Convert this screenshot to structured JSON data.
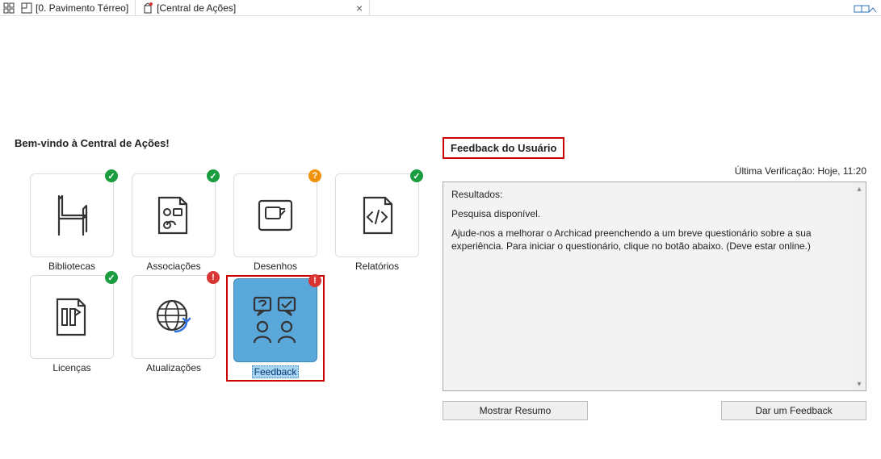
{
  "tabs": {
    "tab1_label": "[0. Pavimento Térreo]",
    "tab2_label": "[Central de Ações]"
  },
  "left": {
    "welcome": "Bem-vindo à Central de Ações!",
    "tiles": {
      "bibliotecas": {
        "label": "Bibliotecas"
      },
      "associacoes": {
        "label": "Associações"
      },
      "desenhos": {
        "label": "Desenhos"
      },
      "relatorios": {
        "label": "Relatórios"
      },
      "licencas": {
        "label": "Licenças"
      },
      "atualizacoes": {
        "label": "Atualizações"
      },
      "feedback": {
        "label": "Feedback"
      }
    },
    "badges": {
      "check": "✓",
      "question": "?",
      "alert": "!"
    }
  },
  "right": {
    "section_title": "Feedback do Usuário",
    "last_check": "Última Verificação: Hoje, 11:20",
    "results_title": "Resultados:",
    "results_line": "Pesquisa disponível.",
    "results_help": "Ajude-nos a melhorar o Archicad preenchendo a um breve questionário sobre a sua experiência. Para iniciar o questionário, clique no botão abaixo. (Deve estar online.)",
    "btn_summary": "Mostrar Resumo",
    "btn_feedback": "Dar um Feedback"
  }
}
